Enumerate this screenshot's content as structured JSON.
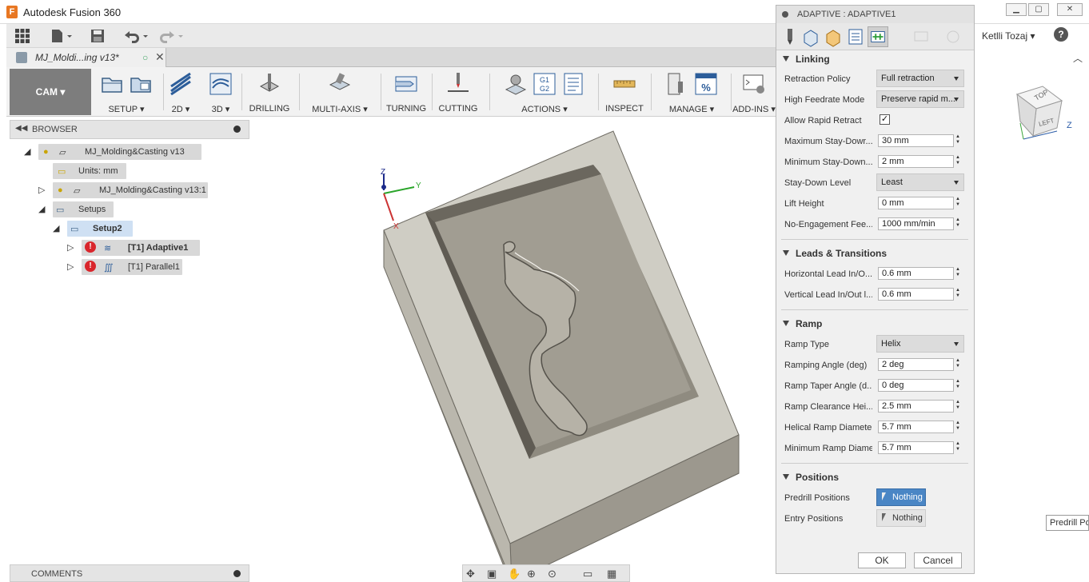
{
  "window": {
    "title": "Autodesk Fusion 360",
    "app_icon_letter": "F"
  },
  "document_tab": {
    "name": "MJ_Moldi...ing v13*"
  },
  "toolbar": {
    "workspace": "CAM",
    "groups": [
      {
        "label": "SETUP"
      },
      {
        "label": "2D"
      },
      {
        "label": "3D"
      },
      {
        "label": "DRILLING"
      },
      {
        "label": "MULTI-AXIS"
      },
      {
        "label": "TURNING"
      },
      {
        "label": "CUTTING"
      },
      {
        "label": "ACTIONS"
      },
      {
        "label": "INSPECT"
      },
      {
        "label": "MANAGE"
      },
      {
        "label": "ADD-INS"
      }
    ],
    "actions_g_label_1": "G1",
    "actions_g_label_2": "G2",
    "manage_percent": "%"
  },
  "browser": {
    "header": "BROWSER",
    "nodes": [
      {
        "label": "MJ_Molding&Casting v13"
      },
      {
        "label": "Units: mm"
      },
      {
        "label": "MJ_Molding&Casting v13:1"
      },
      {
        "label": "Setups"
      },
      {
        "label": "Setup2"
      },
      {
        "label": "[T1] Adaptive1"
      },
      {
        "label": "[T1] Parallel1"
      }
    ]
  },
  "comments": {
    "label": "COMMENTS"
  },
  "user": {
    "name": "Ketlli Tozaj",
    "help": "?"
  },
  "viewcube": {
    "top": "TOP",
    "left": "LEFT",
    "axis_z": "Z"
  },
  "viewport_axes": {
    "z": "Z",
    "x": "X",
    "y": "Y"
  },
  "tooltip": {
    "text": "Predrill Pos"
  },
  "dialog": {
    "title": "ADAPTIVE : ADAPTIVE1",
    "sections": {
      "linking": "Linking",
      "leads": "Leads & Transitions",
      "ramp": "Ramp",
      "positions": "Positions"
    },
    "params": {
      "retraction_policy": {
        "label": "Retraction Policy",
        "value": "Full retraction"
      },
      "high_feedrate_mode": {
        "label": "High Feedrate Mode",
        "value": "Preserve rapid m..."
      },
      "allow_rapid_retract": {
        "label": "Allow Rapid Retract",
        "check": "✓"
      },
      "max_stay_down": {
        "label": "Maximum Stay-Dowr...",
        "value": "30 mm"
      },
      "min_stay_down": {
        "label": "Minimum Stay-Down...",
        "value": "2 mm"
      },
      "stay_down_level": {
        "label": "Stay-Down Level",
        "value": "Least"
      },
      "lift_height": {
        "label": "Lift Height",
        "value": "0 mm"
      },
      "no_engagement_feed": {
        "label": "No-Engagement Fee...",
        "value": "1000 mm/min"
      },
      "horizontal_lead": {
        "label": "Horizontal Lead In/O...",
        "value": "0.6 mm"
      },
      "vertical_lead": {
        "label": "Vertical Lead In/Out l...",
        "value": "0.6 mm"
      },
      "ramp_type": {
        "label": "Ramp Type",
        "value": "Helix"
      },
      "ramping_angle": {
        "label": "Ramping Angle (deg)",
        "value": "2 deg"
      },
      "ramp_taper_angle": {
        "label": "Ramp Taper Angle (d...",
        "value": "0 deg"
      },
      "ramp_clearance": {
        "label": "Ramp Clearance Hei...",
        "value": "2.5 mm"
      },
      "helical_ramp_diameter": {
        "label": "Helical Ramp Diameter",
        "value": "5.7 mm"
      },
      "min_ramp_diameter": {
        "label": "Minimum Ramp Diame...",
        "value": "5.7 mm"
      },
      "predrill_positions": {
        "label": "Predrill Positions",
        "value": "Nothing"
      },
      "entry_positions": {
        "label": "Entry Positions",
        "value": "Nothing"
      }
    },
    "ok": "OK",
    "cancel": "Cancel"
  },
  "colors": {
    "selection_blue": "#4a86c5",
    "error_red": "#d9262c",
    "model_gray": "#8f8b80"
  }
}
